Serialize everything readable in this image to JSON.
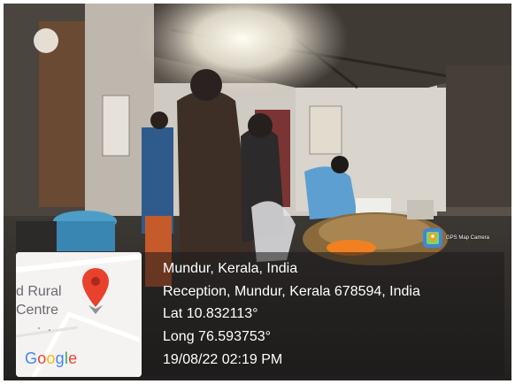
{
  "stamp": {
    "app_name": "GPS Map Camera",
    "app_icon": "gps-map-camera-icon"
  },
  "map": {
    "label_line1": "d Rural",
    "label_line2": "Centre",
    "pin_icon": "map-pin-icon",
    "pin_color": "#e8412c",
    "logo_letters": [
      {
        "char": "G",
        "color": "#4285f4"
      },
      {
        "char": "o",
        "color": "#ea4335"
      },
      {
        "char": "o",
        "color": "#fbbc05"
      },
      {
        "char": "g",
        "color": "#4285f4"
      },
      {
        "char": "l",
        "color": "#34a853"
      },
      {
        "char": "e",
        "color": "#ea4335"
      }
    ]
  },
  "location": {
    "place": "Mundur, Kerala, India",
    "address": "Reception, Mundur, Kerala 678594, India",
    "lat": "Lat 10.832113°",
    "long": "Long 76.593753°",
    "datetime": "19/08/22 02:19 PM"
  }
}
